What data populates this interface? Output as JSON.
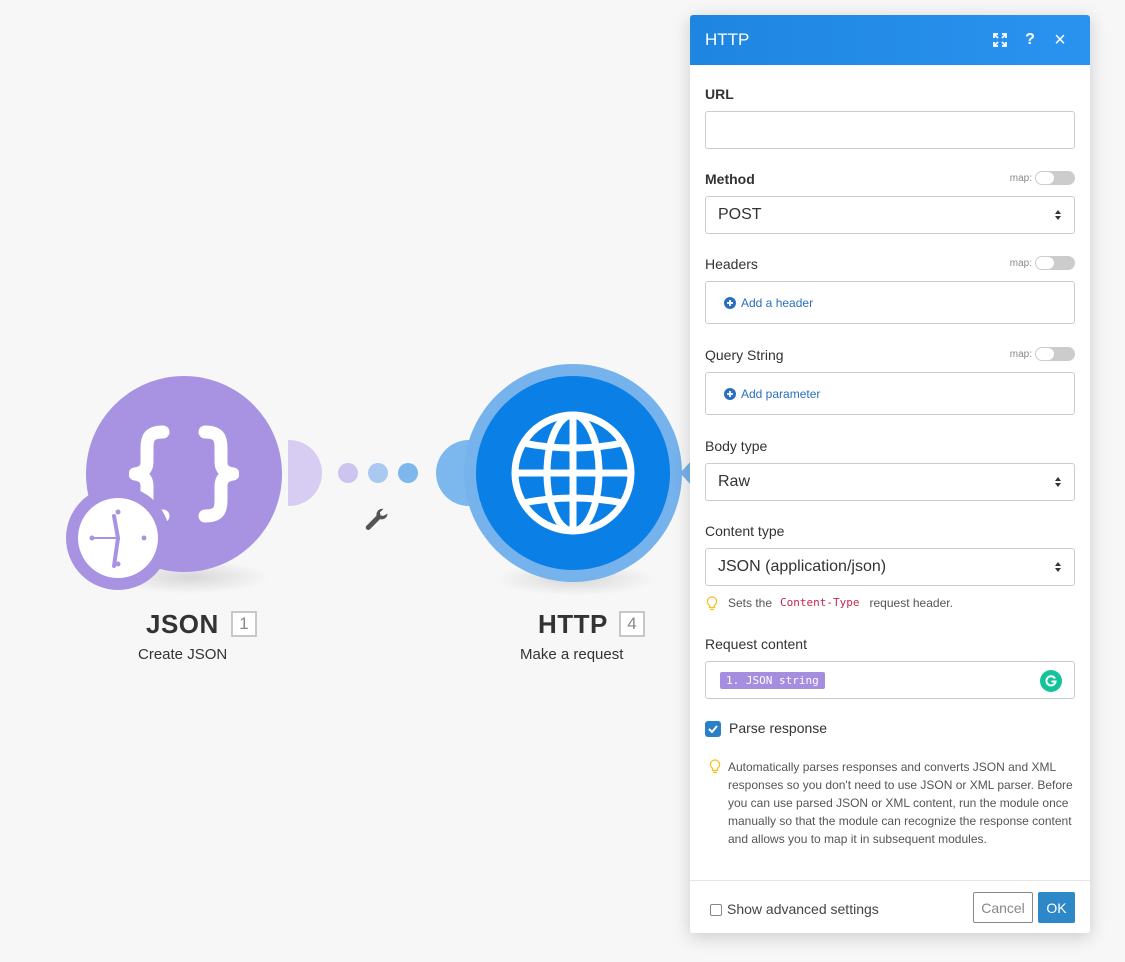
{
  "scenario": {
    "modules": [
      {
        "title": "JSON",
        "badge": "1",
        "subtitle": "Create JSON",
        "color": "#a793e2",
        "icon": "braces-icon"
      },
      {
        "title": "HTTP",
        "badge": "4",
        "subtitle": "Make a request",
        "color": "#0a7fe6",
        "icon": "globe-icon"
      }
    ],
    "connector_icon": "wrench-icon",
    "trigger_icon": "clock-icon"
  },
  "dialog": {
    "title": "HTTP",
    "header_icons": [
      "expand-icon",
      "help-icon",
      "close-icon"
    ],
    "help_label": "?",
    "close_label": "×",
    "map_label": "map:",
    "url": {
      "label": "URL",
      "value": ""
    },
    "method": {
      "label": "Method",
      "value": "POST"
    },
    "headers": {
      "label": "Headers",
      "add_label": "Add a header"
    },
    "query_string": {
      "label": "Query String",
      "add_label": "Add parameter"
    },
    "body_type": {
      "label": "Body type",
      "value": "Raw"
    },
    "content_type": {
      "label": "Content type",
      "value": "JSON (application/json)",
      "hint_prefix": "Sets the",
      "hint_code": "Content-Type",
      "hint_suffix": "request header."
    },
    "request_content": {
      "label": "Request content",
      "pill": "1. JSON string"
    },
    "parse_response": {
      "label": "Parse response",
      "checked": true,
      "description": "Automatically parses responses and converts JSON and XML responses so you don't need to use JSON or XML parser. Before you can use parsed JSON or XML content, run the module once manually so that the module can recognize the response content and allows you to map it in subsequent modules."
    },
    "footer": {
      "advanced_label": "Show advanced settings",
      "cancel_label": "Cancel",
      "ok_label": "OK"
    }
  },
  "colors": {
    "accent": "#1e86e0",
    "json_module": "#a793e2",
    "http_module": "#0a7fe6",
    "ok_button": "#2e88c7"
  }
}
